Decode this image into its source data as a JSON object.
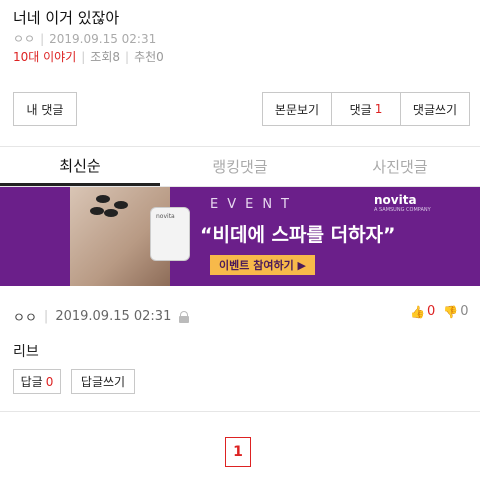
{
  "post": {
    "title": "너네 이거 있잖아",
    "author": "ㅇㅇ",
    "datetime": "2019.09.15 02:31",
    "board": "10대 이야기",
    "views_label": "조회",
    "views": "8",
    "recommend_label": "추천",
    "recommend": "0"
  },
  "actions": {
    "my_comment": "내 댓글",
    "view_body": "본문보기",
    "comments_label": "댓글",
    "comments_count": "1",
    "write_comment": "댓글쓰기"
  },
  "tabs": [
    {
      "label": "최신순",
      "active": true
    },
    {
      "label": "랭킹댓글",
      "active": false
    },
    {
      "label": "사진댓글",
      "active": false
    }
  ],
  "banner": {
    "event": "EVENT",
    "headline": "“비데에 스파를 더하자”",
    "cta": "이벤트 참여하기 ▶",
    "brand": "novita",
    "brand_sub": "A SAMSUNG COMPANY",
    "device_label": "novita",
    "colors": {
      "background": "#6b1f8a",
      "cta": "#f7b94a"
    }
  },
  "comment": {
    "author": "ㅇㅇ",
    "datetime": "2019.09.15 02:31",
    "icon": "lock-icon",
    "upvotes": "0",
    "downvotes": "0",
    "body": "리브",
    "reply_label": "답글",
    "reply_count": "0",
    "reply_write": "답글쓰기"
  },
  "pagination": {
    "current_page": "1"
  },
  "colors": {
    "accent": "#d22222",
    "border": "#c8c8c8",
    "muted_text": "#aaaaaa"
  }
}
